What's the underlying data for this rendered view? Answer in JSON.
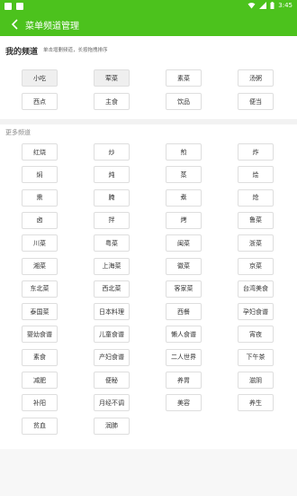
{
  "status": {
    "time": "3:45"
  },
  "toolbar": {
    "title": "菜单频道管理"
  },
  "my_channels": {
    "title": "我的频道",
    "hint": "单击增删频道，长按拖拽排序",
    "items": [
      "小吃",
      "荤菜",
      "素菜",
      "汤粥",
      "西点",
      "主食",
      "饮品",
      "便当"
    ]
  },
  "more_channels": {
    "title": "更多频道",
    "items": [
      "红烧",
      "炒",
      "煎",
      "炸",
      "焖",
      "炖",
      "蒸",
      "烩",
      "熏",
      "腌",
      "煮",
      "炝",
      "卤",
      "拌",
      "烤",
      "鲁菜",
      "川菜",
      "粤菜",
      "闽菜",
      "浙菜",
      "湘菜",
      "上海菜",
      "徽菜",
      "京菜",
      "东北菜",
      "西北菜",
      "客家菜",
      "台湾美食",
      "泰国菜",
      "日本料理",
      "西餐",
      "孕妇食谱",
      "婴幼食谱",
      "儿童食谱",
      "懒人食谱",
      "宵夜",
      "素食",
      "产妇食谱",
      "二人世界",
      "下午茶",
      "减肥",
      "便秘",
      "养胃",
      "滋阴",
      "补阳",
      "月经不调",
      "美容",
      "养生",
      "贫血",
      "润肺"
    ]
  }
}
